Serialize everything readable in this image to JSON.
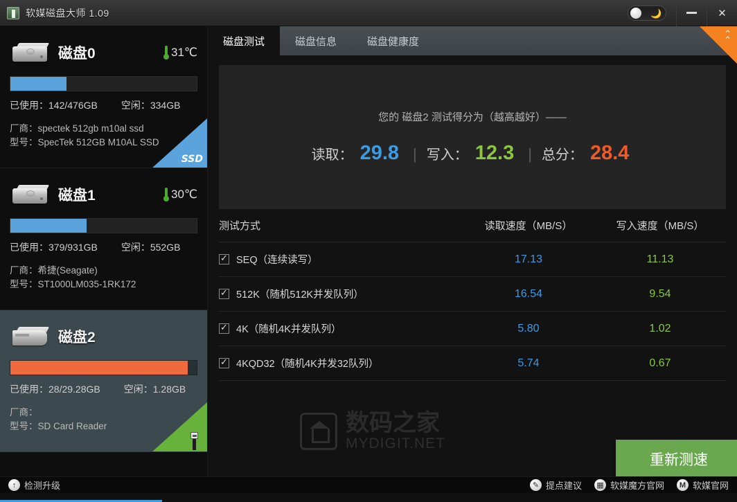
{
  "window": {
    "title": "软媒磁盘大师 1.09",
    "app_icon": "disk-app-icon",
    "daynight_toggle": "day-night-toggle",
    "minimize": "—",
    "close": "✕"
  },
  "sidebar": {
    "disks": [
      {
        "name": "磁盘0",
        "temp": "31℃",
        "used_label": "已使用：142/476GB",
        "free_label": "空闲：334GB",
        "vendor_label": "厂商：spectek 512gb m10al ssd",
        "model_label": "型号：SpecTek 512GB M10AL SSD",
        "badge": "SSD",
        "fill_percent": 30,
        "fill_color": "#5ba3dd",
        "selected": false
      },
      {
        "name": "磁盘1",
        "temp": "30℃",
        "used_label": "已使用：379/931GB",
        "free_label": "空闲：552GB",
        "vendor_label": "厂商：希捷(Seagate)",
        "model_label": "型号：ST1000LM035-1RK172",
        "badge": "",
        "fill_percent": 41,
        "fill_color": "#5ba3dd",
        "selected": false
      },
      {
        "name": "磁盘2",
        "temp": "",
        "used_label": "已使用：28/29.28GB",
        "free_label": "空闲：1.28GB",
        "vendor_label": "厂商：",
        "model_label": "型号：SD Card Reader",
        "badge": "USB",
        "fill_percent": 95,
        "fill_color": "#ef6a3d",
        "selected": true
      }
    ]
  },
  "main": {
    "tabs": [
      {
        "label": "磁盘测试",
        "active": true
      },
      {
        "label": "磁盘信息",
        "active": false
      },
      {
        "label": "磁盘健康度",
        "active": false
      }
    ],
    "ribbon_icon": "double-chevron-up-icon",
    "score": {
      "subtitle": "您的 磁盘2 测试得分为（越高越好）——",
      "read_label": "读取：",
      "read_value": "29.8",
      "write_label": "写入：",
      "write_value": "12.3",
      "total_label": "总分：",
      "total_value": "28.4",
      "read_color": "#3d9be0",
      "write_color": "#8cc63f",
      "total_color": "#f05a28",
      "separator": "|"
    },
    "table": {
      "headers": {
        "name": "测试方式",
        "read": "读取速度（MB/S）",
        "write": "写入速度（MB/S）"
      },
      "rows": [
        {
          "checked": true,
          "name": "SEQ（连续读写）",
          "read": "17.13",
          "write": "11.13"
        },
        {
          "checked": true,
          "name": "512K（随机512K并发队列）",
          "read": "16.54",
          "write": "9.54"
        },
        {
          "checked": true,
          "name": "4K（随机4K并发队列）",
          "read": "5.80",
          "write": "1.02"
        },
        {
          "checked": true,
          "name": "4KQD32（随机4K并发32队列）",
          "read": "5.74",
          "write": "0.67"
        }
      ]
    },
    "watermark": {
      "cn": "数码之家",
      "en": "MYDIGIT.NET"
    },
    "retest_button": "重新测速"
  },
  "statusbar": {
    "upgrade": "检测升级",
    "links": [
      {
        "icon": "pencil-icon",
        "glyph": "✎",
        "label": "提点建议"
      },
      {
        "icon": "grid-icon",
        "glyph": "▦",
        "label": "软媒魔方官网"
      },
      {
        "icon": "m-logo-icon",
        "glyph": "M",
        "label": "软媒官网"
      }
    ]
  }
}
